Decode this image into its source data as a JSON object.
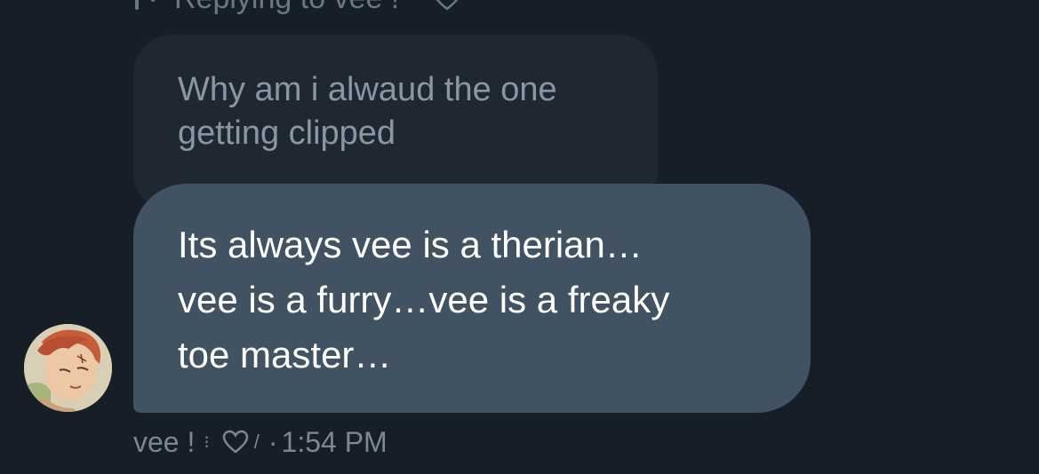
{
  "reply_header": {
    "text": "Replying to vee !"
  },
  "quoted_message": {
    "text": "Why am i alwaud the one\ngetting clipped"
  },
  "message": {
    "text": "Its always vee is a therian…\nvee is a furry…vee is a freaky\ntoe master…"
  },
  "footer": {
    "sender": "vee !",
    "separator": "⁝",
    "slash": "/",
    "dot": "·",
    "time": "1:54 PM"
  },
  "colors": {
    "background": "#161e27",
    "quoted_bubble": "#1f2732",
    "main_bubble": "#415262",
    "muted_text": "#7d8794"
  },
  "icons": {
    "reply": "reply-arrow-icon",
    "like": "heart-outline-icon",
    "avatar": "user-avatar-image"
  }
}
